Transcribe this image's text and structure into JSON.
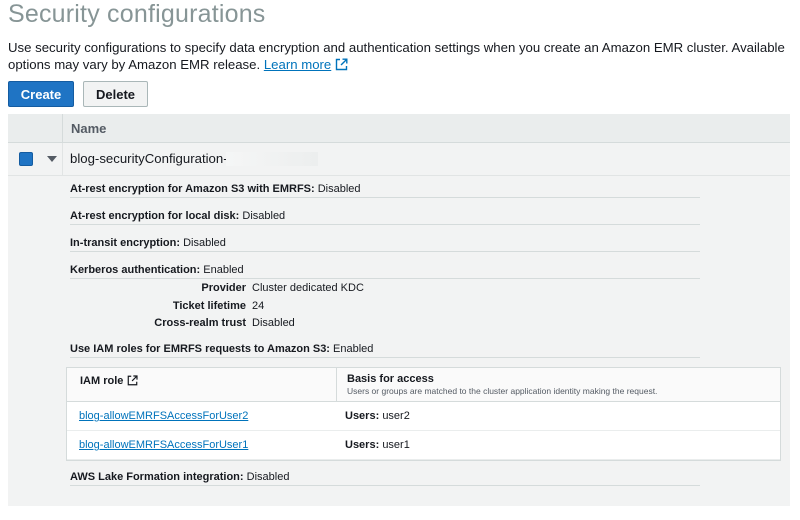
{
  "page": {
    "title": "Security configurations",
    "description": "Use security configurations to specify data encryption and authentication settings when you create an Amazon EMR cluster. Available options may vary by Amazon EMR release.",
    "learn_more": "Learn more"
  },
  "toolbar": {
    "create_label": "Create",
    "delete_label": "Delete"
  },
  "table": {
    "column_name": "Name",
    "row": {
      "name": "blog-securityConfiguration-",
      "selected": true,
      "details": {
        "s3_label": "At-rest encryption for Amazon S3 with EMRFS:",
        "s3_value": "Disabled",
        "disk_label": "At-rest encryption for local disk:",
        "disk_value": "Disabled",
        "transit_label": "In-transit encryption:",
        "transit_value": "Disabled",
        "kerberos_label": "Kerberos authentication:",
        "kerberos_value": "Enabled",
        "kerberos": {
          "provider_label": "Provider",
          "provider_value": "Cluster dedicated KDC",
          "ticket_label": "Ticket lifetime",
          "ticket_value": "24",
          "cross_label": "Cross-realm trust",
          "cross_value": "Disabled"
        },
        "iam_label": "Use IAM roles for EMRFS requests to Amazon S3:",
        "iam_value": "Enabled",
        "iam_table": {
          "col1": "IAM role",
          "col2": "Basis for access",
          "col2_sub": "Users or groups are matched to the cluster application identity making the request.",
          "rows": [
            {
              "role": "blog-allowEMRFSAccessForUser2",
              "users_label": "Users:",
              "users_value": "user2"
            },
            {
              "role": "blog-allowEMRFSAccessForUser1",
              "users_label": "Users:",
              "users_value": "user1"
            }
          ]
        },
        "lake_label": "AWS Lake Formation integration:",
        "lake_value": "Disabled"
      }
    }
  },
  "colors": {
    "primary": "#1f74c4",
    "link": "#0073bb",
    "title": "#879596",
    "panel": "#f2f3f3"
  },
  "icons": [
    "external-link-icon",
    "checkbox-icon",
    "caret-down-icon"
  ]
}
